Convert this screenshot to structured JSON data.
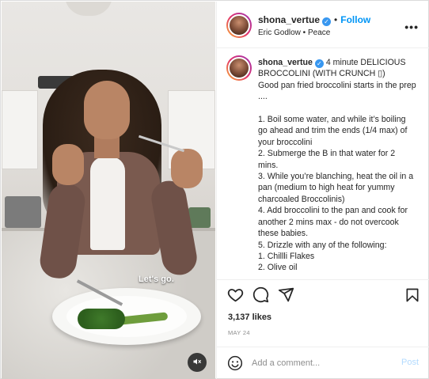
{
  "post": {
    "username": "shona_vertue",
    "follow_label": "Follow",
    "subline": "Eric Godlow • Peace",
    "more_label": "•••"
  },
  "media": {
    "caption_overlay": "Let's go."
  },
  "caption": {
    "username": "shona_vertue",
    "text": "4 minute DELICIOUS BROCCOLINI (WITH CRUNCH ▯)\nGood pan fried broccolini starts in the prep ....\n\n1. Boil some water, and while it’s boiling go ahead and trim the ends (1/4 max) of your broccolini\n2. Submerge the B in that water for 2 mins.\n3. While you’re blanching, heat the oil in a pan (medium to high heat for yummy charcoaled Broccolinis)\n4. Add broccolini to the pan and cook for another 2 mins max - do not overcook these babies.\n5. Drizzle with any of the following:\n1. Chillli Flakes\n2. Olive oil"
  },
  "stats": {
    "likes": "3,137 likes",
    "date": "MAY 24"
  },
  "comment": {
    "placeholder": "Add a comment...",
    "post_label": "Post"
  },
  "colors": {
    "accent": "#0095f6",
    "verified": "#3897f0",
    "post_disabled": "#b3dbff"
  },
  "icons": [
    "heart-icon",
    "comment-icon",
    "share-icon",
    "bookmark-icon",
    "emoji-icon",
    "mute-icon",
    "verified-icon",
    "more-icon"
  ]
}
